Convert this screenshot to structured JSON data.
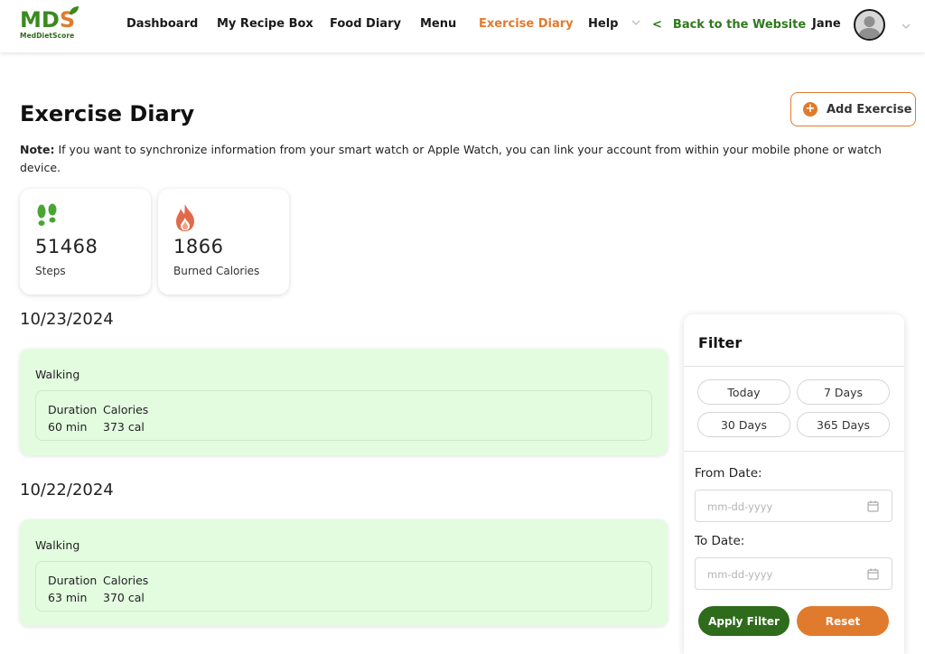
{
  "brand": {
    "logo_text_m": "MD",
    "logo_text_s": "S",
    "logo_sub": "MedDietScore",
    "green": "#3a8a1e",
    "orange": "#e07b2e",
    "dark_green": "#2e6b1a"
  },
  "nav": {
    "items": [
      {
        "label": "Dashboard"
      },
      {
        "label": "My Recipe Box"
      },
      {
        "label": "Food Diary"
      },
      {
        "label": "Menu"
      },
      {
        "label": "Exercise Diary",
        "active": true
      },
      {
        "label": "Help"
      }
    ],
    "back_arrow": "<",
    "back_label": "Back to the Website",
    "user_name": "Jane"
  },
  "page": {
    "title": "Exercise Diary",
    "add_button": "Add Exercise",
    "note_label": "Note:",
    "note_text": " If you want to synchronize information from your smart watch or Apple Watch, you can link your account from within your mobile phone or watch device."
  },
  "stats": [
    {
      "icon": "footprints-icon",
      "value": "51468",
      "caption": "Steps"
    },
    {
      "icon": "flame-icon",
      "value": "1866",
      "caption": "Burned Calories"
    }
  ],
  "entries": [
    {
      "date": "10/23/2024",
      "exercise": "Walking",
      "duration_label": "Duration",
      "duration": "60 min",
      "calories_label": "Calories",
      "calories": "373 cal"
    },
    {
      "date": "10/22/2024",
      "exercise": "Walking",
      "duration_label": "Duration",
      "duration": "63 min",
      "calories_label": "Calories",
      "calories": "370 cal"
    }
  ],
  "filter": {
    "title": "Filter",
    "quick_ranges": [
      "Today",
      "7 Days",
      "30 Days",
      "365 Days"
    ],
    "from_label": "From Date:",
    "from_placeholder": "mm-dd-yyyy",
    "to_label": "To Date:",
    "to_placeholder": "mm-dd-yyyy",
    "apply_label": "Apply Filter",
    "reset_label": "Reset"
  }
}
